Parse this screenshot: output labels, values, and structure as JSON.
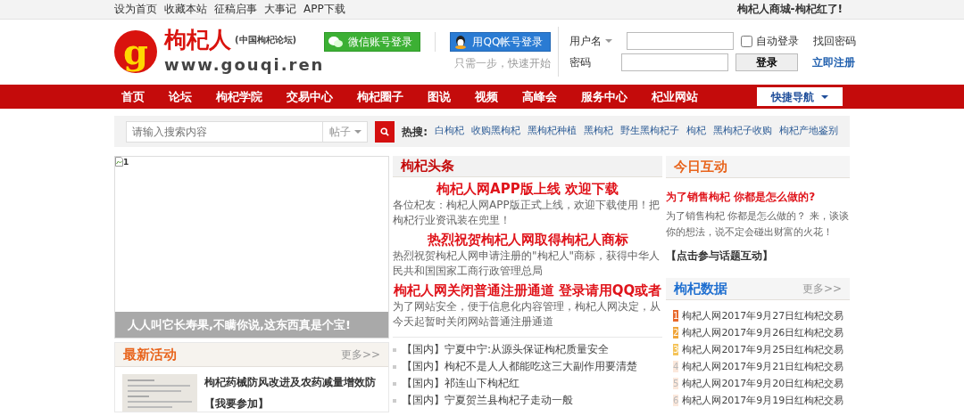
{
  "top_bar": {
    "links": [
      "设为首页",
      "收藏本站",
      "征稿启事",
      "大事记",
      "APP下载"
    ],
    "promo": "枸杞人商城-枸杞红了!"
  },
  "header": {
    "logo": {
      "letter": "g",
      "name": "枸杞人",
      "subtitle": "(中国枸杞论坛)",
      "url": "www.gouqi.ren"
    },
    "wechat_button": "微信账号登录",
    "qq_button": "用QQ帐号登录",
    "hint": "只需一步，快速开始",
    "login": {
      "username_label": "用户名",
      "password_label": "密码",
      "auto_login": {
        "label": "自动登录",
        "checked": false
      },
      "login_button": "登录",
      "forgot": "找回密码",
      "register": "立即注册"
    }
  },
  "nav": {
    "items": [
      "首页",
      "论坛",
      "枸杞学院",
      "交易中心",
      "枸杞圈子",
      "图说",
      "视频",
      "高峰会",
      "服务中心",
      "杞业网站"
    ],
    "quick_nav": "快捷导航"
  },
  "search": {
    "placeholder": "请输入搜索内容",
    "scope": "帖子",
    "hot_label": "热搜:",
    "hot_terms": [
      "白枸杞",
      "收购黑枸杞",
      "黑枸杞种植",
      "黑枸杞",
      "野生黑枸杞子",
      "枸杞",
      "黑枸杞子收购",
      "枸杞产地鉴别"
    ]
  },
  "slideshow": {
    "alt_text": "1",
    "caption": "人人叫它长寿果,不瞒你说,这东西真是个宝!"
  },
  "activities": {
    "title": "最新活动",
    "more": "更多>>",
    "items": [
      {
        "title": "枸杞药械防风改进及农药减量增效防",
        "action": "【我要参加】"
      }
    ]
  },
  "headlines": {
    "title": "枸杞头条",
    "stories": [
      {
        "title": "枸杞人网APP版上线 欢迎下载",
        "summary": "各位杞友：枸杞人网APP版正式上线，欢迎下载使用！把枸杞行业资讯装在兜里！"
      },
      {
        "title": "热烈祝贺枸杞人网取得枸杞人商标",
        "summary": "热烈祝贺枸杞人网申请注册的\"枸杞人\"商标，获得中华人民共和国国家工商行政管理总局"
      },
      {
        "title": "枸杞人网关闭普通注册通道 登录请用QQ或者",
        "summary": "为了网站安全，便于信息化内容管理，枸杞人网决定，从今天起暂时关闭网站普通注册通道"
      }
    ],
    "news": [
      "【国内】宁夏中宁:从源头保证枸杞质量安全",
      "【国内】枸杞不是人人都能吃这三大副作用要清楚",
      "【国内】祁连山下枸杞红",
      "【国内】宁夏贺兰县枸杞子走动一般"
    ]
  },
  "interaction": {
    "title": "今日互动",
    "question": "为了销售枸杞 你都是怎么做的?",
    "body": "为了销售枸杞 你都是怎么做的？ 来，谈谈你的想法，说不定会碰出财富的火花！",
    "action": "【点击参与话题互动】"
  },
  "data": {
    "title": "枸杞数据",
    "more": "更多>>",
    "items": [
      {
        "rank": "1",
        "title": "枸杞人网2017年9月27日红枸杞交易",
        "color": "#e8692c"
      },
      {
        "rank": "2",
        "title": "枸杞人网2017年9月26日红枸杞交易",
        "color": "#f0a53a"
      },
      {
        "rank": "3",
        "title": "枸杞人网2017年9月25日红枸杞交易",
        "color": "#f5c45a"
      },
      {
        "rank": "4",
        "title": "枸杞人网2017年9月21日红枸杞交易",
        "color": "#fbe8dc"
      },
      {
        "rank": "5",
        "title": "枸杞人网2017年9月20日红枸杞交易",
        "color": "#fbe8dc"
      },
      {
        "rank": "6",
        "title": "枸杞人网2017年9月19日红枸杞交易",
        "color": "#fbe8dc"
      }
    ]
  }
}
